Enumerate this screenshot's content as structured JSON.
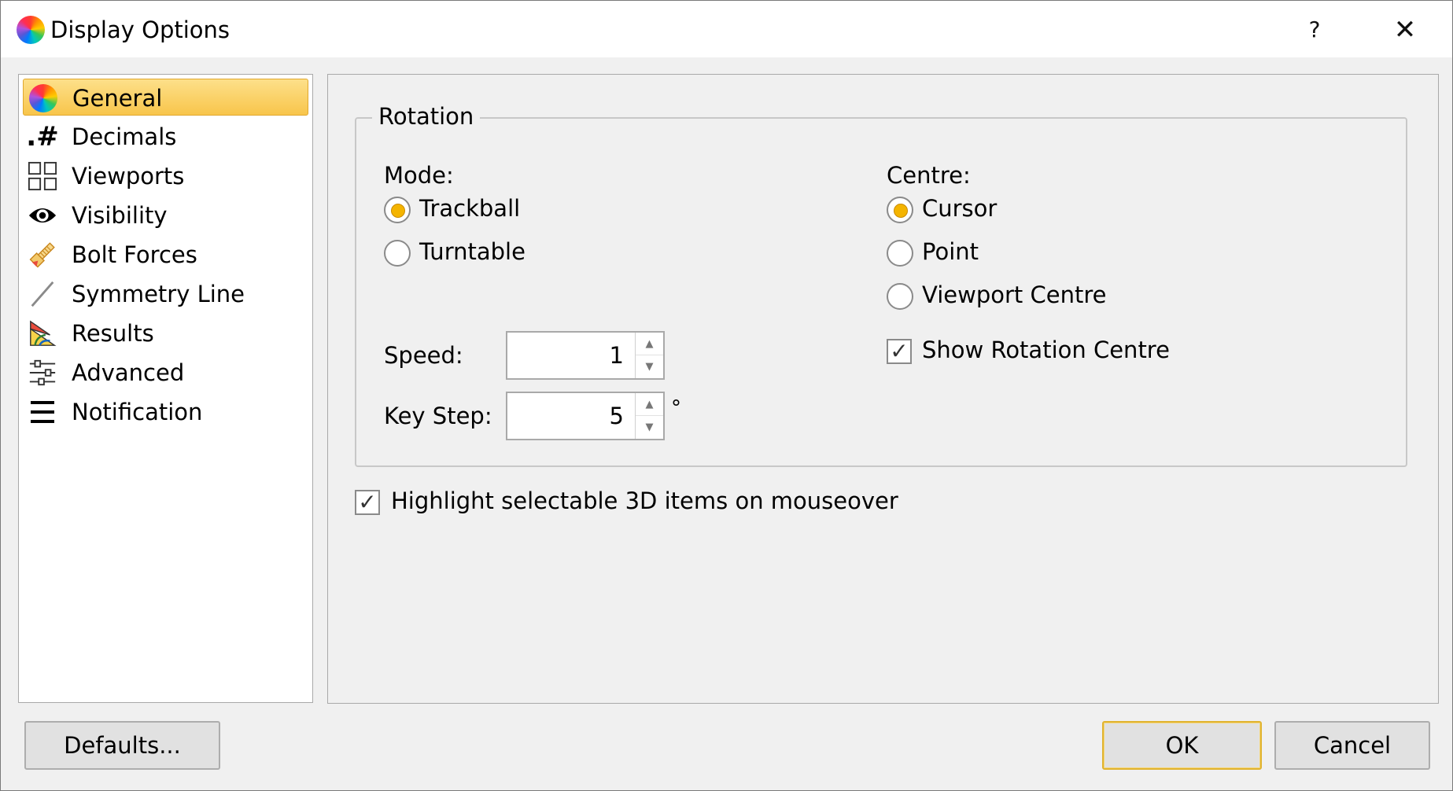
{
  "window": {
    "title": "Display Options",
    "help_label": "?",
    "close_label": "✕"
  },
  "sidebar": {
    "items": [
      {
        "label": "General",
        "icon": "color-wheel-icon",
        "selected": true
      },
      {
        "label": "Decimals",
        "icon": "decimals-icon",
        "selected": false
      },
      {
        "label": "Viewports",
        "icon": "viewports-icon",
        "selected": false
      },
      {
        "label": "Visibility",
        "icon": "eye-icon",
        "selected": false
      },
      {
        "label": "Bolt Forces",
        "icon": "bolt-icon",
        "selected": false
      },
      {
        "label": "Symmetry Line",
        "icon": "symmetry-line-icon",
        "selected": false
      },
      {
        "label": "Results",
        "icon": "results-icon",
        "selected": false
      },
      {
        "label": "Advanced",
        "icon": "sliders-icon",
        "selected": false
      },
      {
        "label": "Notification",
        "icon": "hamburger-icon",
        "selected": false
      }
    ]
  },
  "rotation": {
    "group_title": "Rotation",
    "mode_label": "Mode:",
    "mode_options": [
      {
        "label": "Trackball",
        "checked": true
      },
      {
        "label": "Turntable",
        "checked": false
      }
    ],
    "centre_label": "Centre:",
    "centre_options": [
      {
        "label": "Cursor",
        "checked": true
      },
      {
        "label": "Point",
        "checked": false
      },
      {
        "label": "Viewport Centre",
        "checked": false
      }
    ],
    "show_rotation_centre_label": "Show Rotation Centre",
    "show_rotation_centre_checked": true,
    "speed_label": "Speed:",
    "speed_value": "1",
    "key_step_label": "Key Step:",
    "key_step_value": "5",
    "key_step_unit": "°"
  },
  "highlight": {
    "label": "Highlight selectable 3D items on mouseover",
    "checked": true
  },
  "buttons": {
    "defaults": "Defaults...",
    "ok": "OK",
    "cancel": "Cancel"
  },
  "colors": {
    "selection": "#f8c54b",
    "radio_dot": "#f4b400",
    "default_button_border": "#e0b330"
  }
}
